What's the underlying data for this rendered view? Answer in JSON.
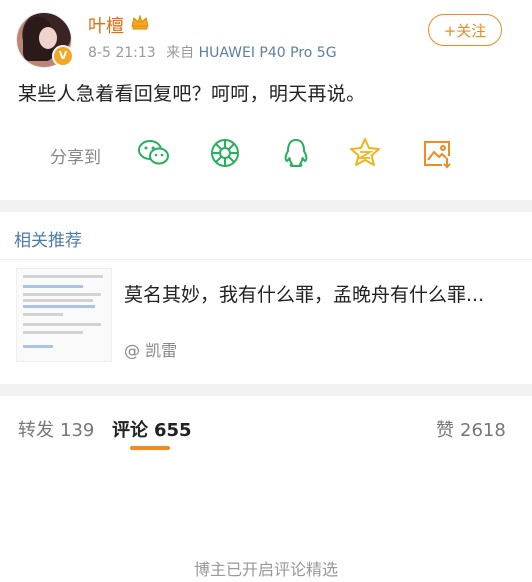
{
  "post": {
    "username": "叶檀",
    "time": "8-5 21:13",
    "source_prefix": "来自",
    "device": "HUAWEI P40 Pro 5G",
    "follow_label": "+关注",
    "content": "某些人急着看回复吧？呵呵，明天再说。"
  },
  "share": {
    "label": "分享到",
    "targets": [
      "wechat-icon",
      "moments-icon",
      "qq-icon",
      "qzone-icon",
      "save-image-icon"
    ],
    "icon_color": "#26b05d"
  },
  "related": {
    "title": "相关推荐",
    "item": {
      "title": "莫名其妙，我有什么罪，孟晚舟有什么罪...",
      "author": "@ 凯雷"
    }
  },
  "tabs": {
    "repost_label": "转发",
    "repost_count": "139",
    "comment_label": "评论",
    "comment_count": "655",
    "like_label": "赞",
    "like_count": "2618"
  },
  "footer_note": "博主已开启评论精选",
  "colors": {
    "accent": "#f08b22",
    "username": "#e86b0a",
    "link": "#4a7cb0"
  }
}
